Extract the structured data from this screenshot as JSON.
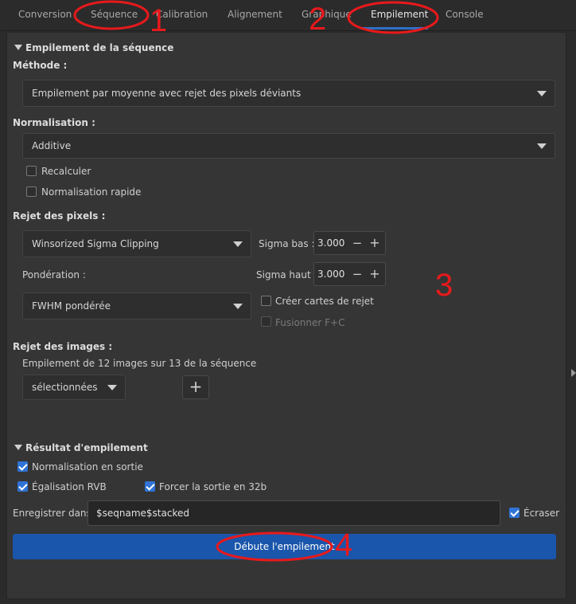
{
  "tabs": [
    "Conversion",
    "Séquence",
    "Calibration",
    "Alignement",
    "Graphique",
    "Empilement",
    "Console"
  ],
  "active_tab": "Empilement",
  "stacking": {
    "section_title": "Empilement de la séquence",
    "method_label": "Méthode :",
    "method_value": "Empilement par moyenne avec rejet des pixels déviants",
    "normalization_label": "Normalisation :",
    "normalization_value": "Additive",
    "recompute_label": "Recalculer",
    "fast_norm_label": "Normalisation rapide",
    "pixel_rejection_label": "Rejet des pixels :",
    "rejection_algo": "Winsorized Sigma Clipping",
    "sigma_low_label": "Sigma bas :",
    "sigma_low_value": "3.000",
    "sigma_high_label": "Sigma haut :",
    "sigma_high_value": "3.000",
    "weighting_label": "Pondération :",
    "weighting_value": "FWHM pondérée",
    "rejection_maps_label": "Créer cartes de rejet",
    "merge_label": "Fusionner F+C",
    "image_rejection_label": "Rejet des images :",
    "image_count_text": "Empilement de 12 images sur 13 de la séquence",
    "image_filter_value": "sélectionnées",
    "plus_symbol": "+",
    "minus_symbol": "−"
  },
  "result": {
    "section_title": "Résultat d'empilement",
    "output_norm_label": "Normalisation en sortie",
    "rgb_eq_label": "Égalisation RVB",
    "force32_label": "Forcer la sortie en 32b",
    "save_in_label": "Enregistrer dans :",
    "save_in_value": "$seqname$stacked",
    "overwrite_label": "Écraser",
    "start_button": "Débute l'empilement"
  },
  "annotations": [
    "1",
    "2",
    "3",
    "4"
  ],
  "colors": {
    "accent": "#2f73d6",
    "primary_button": "#1a56ab",
    "annotation": "#e8191b"
  }
}
